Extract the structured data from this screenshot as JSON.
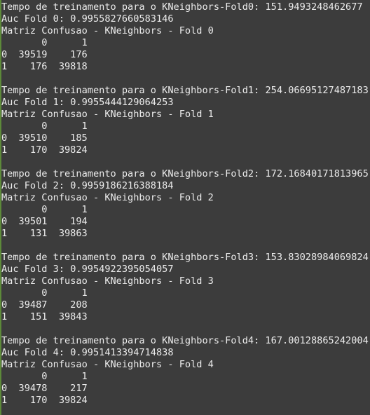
{
  "folds": [
    {
      "time_label": "Tempo de treinamento para o KNeighbors-Fold0: ",
      "time": "151.9493248462677",
      "auc_label": "Auc Fold 0: ",
      "auc": "0.9955827660583146",
      "matrix_title": "Matriz Confusao - KNeighbors - Fold 0",
      "columns": [
        "0",
        "1"
      ],
      "rows": [
        {
          "label": "0",
          "values": [
            "39519",
            "176"
          ]
        },
        {
          "label": "1",
          "values": [
            "176",
            "39818"
          ]
        }
      ]
    },
    {
      "time_label": "Tempo de treinamento para o KNeighbors-Fold1: ",
      "time": "254.06695127487183",
      "auc_label": "Auc Fold 1: ",
      "auc": "0.9955444129064253",
      "matrix_title": "Matriz Confusao - KNeighbors - Fold 1",
      "columns": [
        "0",
        "1"
      ],
      "rows": [
        {
          "label": "0",
          "values": [
            "39510",
            "185"
          ]
        },
        {
          "label": "1",
          "values": [
            "170",
            "39824"
          ]
        }
      ]
    },
    {
      "time_label": "Tempo de treinamento para o KNeighbors-Fold2: ",
      "time": "172.16840171813965",
      "auc_label": "Auc Fold 2: ",
      "auc": "0.9959186216388184",
      "matrix_title": "Matriz Confusao - KNeighbors - Fold 2",
      "columns": [
        "0",
        "1"
      ],
      "rows": [
        {
          "label": "0",
          "values": [
            "39501",
            "194"
          ]
        },
        {
          "label": "1",
          "values": [
            "131",
            "39863"
          ]
        }
      ]
    },
    {
      "time_label": "Tempo de treinamento para o KNeighbors-Fold3: ",
      "time": "153.83028984069824",
      "auc_label": "Auc Fold 3: ",
      "auc": "0.9954922395054057",
      "matrix_title": "Matriz Confusao - KNeighbors - Fold 3",
      "columns": [
        "0",
        "1"
      ],
      "rows": [
        {
          "label": "0",
          "values": [
            "39487",
            "208"
          ]
        },
        {
          "label": "1",
          "values": [
            "151",
            "39843"
          ]
        }
      ]
    },
    {
      "time_label": "Tempo de treinamento para o KNeighbors-Fold4: ",
      "time": "167.00128865242004",
      "auc_label": "Auc Fold 4: ",
      "auc": "0.9951413394714838",
      "matrix_title": "Matriz Confusao - KNeighbors - Fold 4",
      "columns": [
        "0",
        "1"
      ],
      "rows": [
        {
          "label": "0",
          "values": [
            "39478",
            "217"
          ]
        },
        {
          "label": "1",
          "values": [
            "170",
            "39824"
          ]
        }
      ]
    }
  ],
  "colors": {
    "background": "#3c3c3c",
    "text": "#ececec",
    "left_border": "#5d8a3a"
  }
}
